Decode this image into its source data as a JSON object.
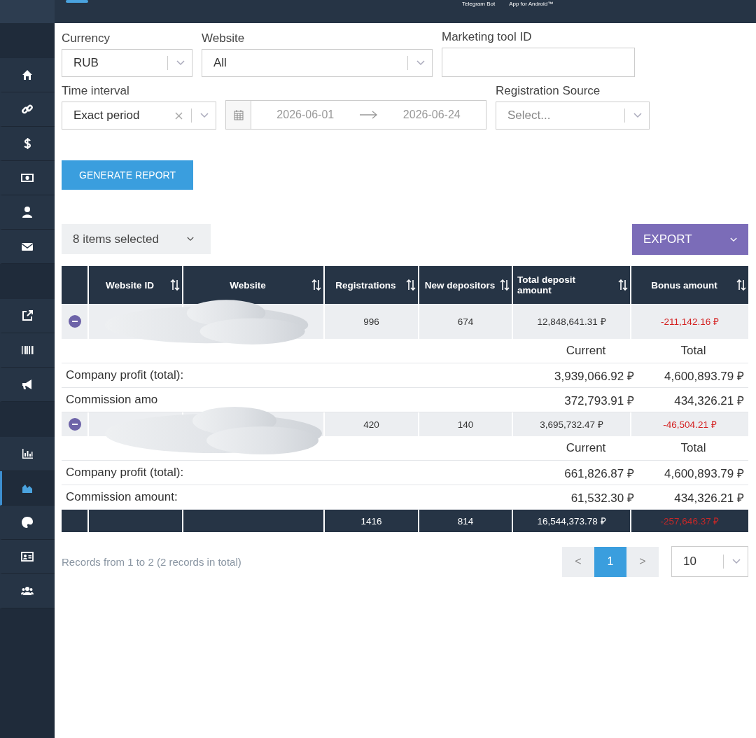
{
  "top_bar": {
    "links": [
      "Telegram Bot",
      "App for Android™"
    ]
  },
  "sidebar": {
    "groups": [
      {
        "items": [
          {
            "selected": false
          },
          {
            "selected": false
          },
          {
            "selected": false
          },
          {
            "selected": false
          },
          {
            "selected": false
          },
          {
            "selected": false
          }
        ]
      },
      {
        "items": [
          {
            "selected": false
          },
          {
            "selected": false
          },
          {
            "selected": false
          }
        ]
      },
      {
        "items": [
          {
            "selected": false
          },
          {
            "selected": true
          },
          {
            "selected": false
          },
          {
            "selected": false
          },
          {
            "selected": false
          }
        ]
      }
    ]
  },
  "filters": {
    "currency": {
      "label": "Currency",
      "value": "RUB"
    },
    "website": {
      "label": "Website",
      "value": "All"
    },
    "marketing_tool_id": {
      "label": "Marketing tool ID"
    },
    "time_interval": {
      "label": "Time interval",
      "value": "Exact period"
    },
    "date_range": {
      "start": "2026-06-01",
      "end": "2026-06-24"
    },
    "registration_source": {
      "label": "Registration Source",
      "placeholder": "Select..."
    }
  },
  "generate_button": "GENERATE REPORT",
  "columns_select": "8 items selected",
  "export_button": "EXPORT",
  "table": {
    "columns": [
      "Website ID",
      "Website",
      "Registrations",
      "New depositors",
      "Total deposit amount",
      "Bonus amount"
    ],
    "rows": [
      {
        "registrations": "996",
        "new_depositors": "674",
        "total_deposit": "12,848,641.31 ₽",
        "bonus": "-211,142.16 ₽",
        "details": {
          "current_header": "Current",
          "total_header": "Total",
          "lines": [
            {
              "label": "Company profit (total):",
              "current": "3,939,066.92 ₽",
              "total": "4,600,893.79 ₽"
            },
            {
              "label": "Commission amo",
              "current": "372,793.91 ₽",
              "total": "434,326.21 ₽"
            }
          ]
        }
      },
      {
        "registrations": "420",
        "new_depositors": "140",
        "total_deposit": "3,695,732.47 ₽",
        "bonus": "-46,504.21 ₽",
        "details": {
          "current_header": "Current",
          "total_header": "Total",
          "lines": [
            {
              "label": "Company profit (total):",
              "current": "661,826.87 ₽",
              "total": "4,600,893.79 ₽"
            },
            {
              "label": "Commission amount:",
              "current": "61,532.30 ₽",
              "total": "434,326.21 ₽"
            }
          ]
        }
      }
    ],
    "totals": {
      "registrations": "1416",
      "new_depositors": "814",
      "total_deposit": "16,544,373.78 ₽",
      "bonus": "-257,646.37 ₽"
    }
  },
  "records_info": "Records from 1 to 2 (2 records in total)",
  "pagination": {
    "prev": "<",
    "pages": [
      {
        "label": "1",
        "selected": true
      }
    ],
    "next": ">"
  },
  "page_size": "10"
}
